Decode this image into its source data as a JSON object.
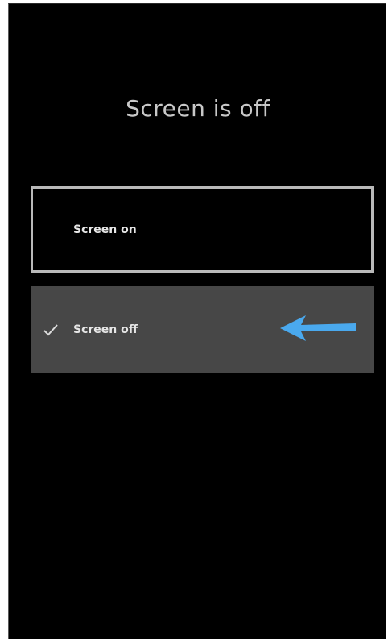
{
  "screen": {
    "title": "Screen is off"
  },
  "options": [
    {
      "label": "Screen on",
      "selected": false
    },
    {
      "label": "Screen off",
      "selected": true
    }
  ],
  "icons": {
    "check": "check-icon",
    "arrow": "arrow-left-icon"
  },
  "colors": {
    "background": "#000000",
    "selected_background": "#474747",
    "focus_border": "#b9b9b9",
    "annotation_arrow": "#4aa9ee"
  }
}
